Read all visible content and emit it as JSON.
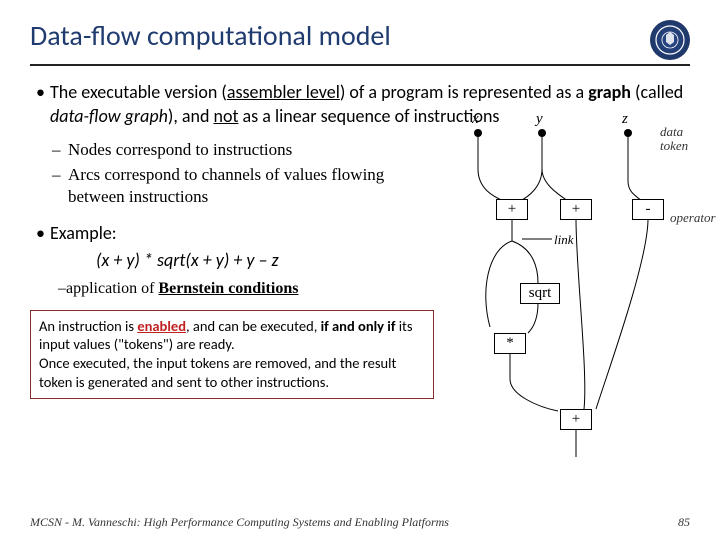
{
  "header": {
    "title": "Data-flow computational model"
  },
  "bullets": {
    "b1": {
      "part1": "The executable version (",
      "part2": "assembler level",
      "part3": ") of a program is represented as a ",
      "part4": "graph",
      "part5": " (called ",
      "part6": "data-flow graph",
      "part7": "), and ",
      "part8": "not",
      "part9": " as a linear sequence of instructions"
    },
    "sub1": "Nodes correspond to instructions",
    "sub2": "Arcs correspond to channels of values flowing between instructions",
    "example_label": "Example:",
    "example_formula": "(x + y) * sqrt(x + y) + y – z",
    "app_text1": "application of ",
    "app_text2": "Bernstein conditions"
  },
  "note": {
    "p1a": "An instruction is ",
    "p1b": "enabled",
    "p1c": ", and can be executed, ",
    "p1d": "if and only if",
    "p1e": " its input values (\"tokens\") are ready.",
    "p2": "Once executed, the input tokens are removed, and the result token is generated and sent to other instructions."
  },
  "diagram": {
    "x": "x",
    "y": "y",
    "z": "z",
    "plus1": "+",
    "plus2": "+",
    "minus": "-",
    "sqrt": "sqrt",
    "mult": "*",
    "link": "link",
    "data_token": "data\ntoken",
    "operator": "operator"
  },
  "footer": {
    "left": "MCSN  -   M. Vanneschi: High Performance Computing Systems and Enabling Platforms",
    "right": "85"
  }
}
